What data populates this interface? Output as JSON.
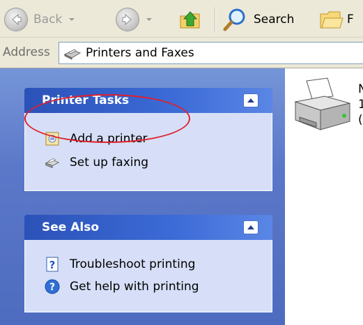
{
  "toolbar": {
    "back_label": "Back",
    "search_label": "Search",
    "folders_label_partial": "F"
  },
  "address": {
    "label": "Address",
    "value": "Printers and Faxes"
  },
  "printer_tasks": {
    "title": "Printer Tasks",
    "items": [
      {
        "label": "Add a printer",
        "icon": "add-printer-icon"
      },
      {
        "label": "Set up faxing",
        "icon": "fax-icon"
      }
    ]
  },
  "see_also": {
    "title": "See Also",
    "items": [
      {
        "label": "Troubleshoot printing",
        "icon": "help-topic-icon"
      },
      {
        "label": "Get help with printing",
        "icon": "help-icon"
      }
    ]
  },
  "content": {
    "printer_name_partial": "N",
    "printer_line2_partial": "1",
    "printer_line3_partial": "("
  },
  "colors": {
    "pane_blue": "#5a77c8",
    "header_blue": "#2b52b8",
    "highlight_red": "#e0202a"
  }
}
